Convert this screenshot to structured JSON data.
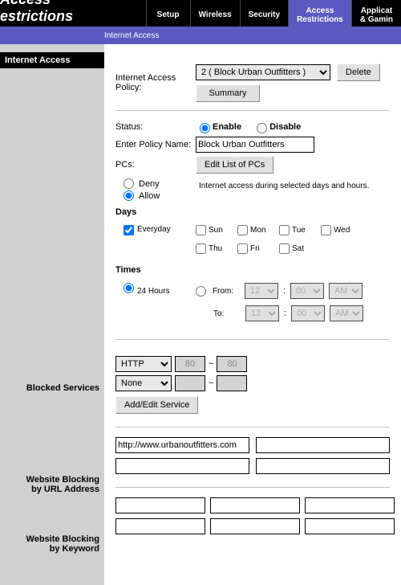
{
  "brand_top": "Access",
  "brand_bottom": "estrictions",
  "tabs": {
    "setup": "Setup",
    "wireless": "Wireless",
    "security": "Security",
    "access1": "Access",
    "access2": "Restrictions",
    "apps1": "Applicat",
    "apps2": "& Gamin"
  },
  "subnav": "Internet Access",
  "sidebar": {
    "internet": "Internet Access",
    "blocked": "Blocked Services",
    "url1": "Website Blocking",
    "url2": "by URL Address",
    "kw1": "Website Blocking",
    "kw2": "by Keyword"
  },
  "policy": {
    "label1": "Internet Access",
    "label2": "Policy:",
    "select_value": "2 ( Block Urban Outfitters )",
    "delete": "Delete",
    "summary": "Summary"
  },
  "status": {
    "label": "Status:",
    "enable": "Enable",
    "disable": "Disable"
  },
  "name": {
    "label": "Enter Policy Name:",
    "value": "Block Urban Outfitters"
  },
  "pcs": {
    "label": "PCs:",
    "edit": "Edit List of PCs",
    "deny": "Deny",
    "allow": "Allow",
    "note": "Internet access during selected days and hours."
  },
  "days": {
    "heading": "Days",
    "everyday": "Everyday",
    "sun": "Sun",
    "mon": "Mon",
    "tue": "Tue",
    "wed": "Wed",
    "thu": "Thu",
    "fri": "Fri",
    "sat": "Sat"
  },
  "times": {
    "heading": "Times",
    "allday": "24 Hours",
    "from": "From:",
    "to": "To:",
    "h": "12",
    "m": "00",
    "ap": "AM",
    "colon": ":"
  },
  "svc": {
    "http": "HTTP",
    "none": "None",
    "p80a": "80",
    "p80b": "80",
    "tilde": "~",
    "addedit": "Add/Edit Service"
  },
  "url": {
    "v1": "http://www.urbanoutfitters.com"
  }
}
